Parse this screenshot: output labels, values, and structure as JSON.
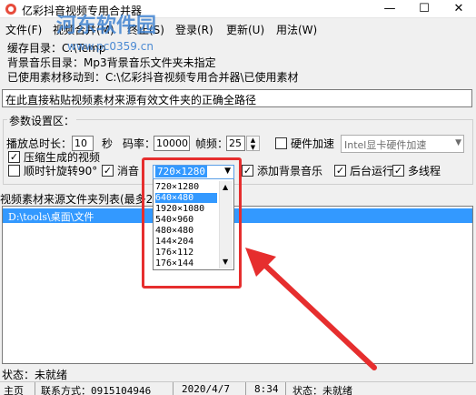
{
  "window": {
    "title": "亿彩抖音视频专用合并器",
    "minimize_glyph": "—",
    "maximize_glyph": "☐",
    "close_glyph": "✕"
  },
  "menu": {
    "items": [
      "文件(F)",
      "视频合并(M)",
      "终止(S)",
      "登录(R)",
      "更新(U)",
      "用法(W)"
    ]
  },
  "info": {
    "temp_dir": "缓存目录：C:\\Temp",
    "music_dir": "背景音乐目录：Mp3背景音乐文件夹未指定",
    "moved_to": "已使用素材移动到：C:\\亿彩抖音视频专用合并器\\已使用素材"
  },
  "path_input": {
    "value": "在此直接粘贴视频素材来源有效文件夹的正确全路径"
  },
  "params": {
    "legend": "参数设置区：",
    "duration_label": "播放总时长：",
    "duration_value": "10",
    "seconds_label": "秒",
    "bitrate_label": "码率：",
    "bitrate_value": "10000",
    "fps_label": "帧频：",
    "fps_value": "25",
    "hw_accel_label": "硬件加速",
    "hw_accel_checked": false,
    "hw_combo_value": "Intel显卡硬件加速",
    "compress_label": "压缩生成的视频",
    "compress_checked": true,
    "rotate_label": "顺时针旋转90°",
    "rotate_checked": false,
    "mute_label": "消音",
    "mute_checked": true,
    "resolution_value": "720×1280",
    "bgm_label": "添加背景音乐",
    "bgm_checked": true,
    "background_run_label": "后台运行",
    "background_run_checked": true,
    "multithread_label": "多线程",
    "multithread_checked": true
  },
  "list": {
    "label": "视频素材来源文件夹列表(最多2",
    "rows": [
      "D:\\tools\\桌面\\文件"
    ]
  },
  "dropdown": {
    "options": [
      "720×1280",
      "640×480",
      "1920×1080",
      "540×960",
      "480×480",
      "144×204",
      "176×112",
      "176×144"
    ],
    "highlighted_index": 1
  },
  "status": {
    "text": "状态：未就绪"
  },
  "statusbar": {
    "page": "主页",
    "contact": "联系方式：0915104946",
    "date": "2020/4/7",
    "time": "8:34",
    "state": "状态：未就绪"
  },
  "watermark": {
    "title": "河东软件园",
    "url": "www.pc0359.cn"
  },
  "colors": {
    "selection": "#3399ff",
    "annotation": "#e62e2e",
    "watermark": "#3a7fd0"
  }
}
